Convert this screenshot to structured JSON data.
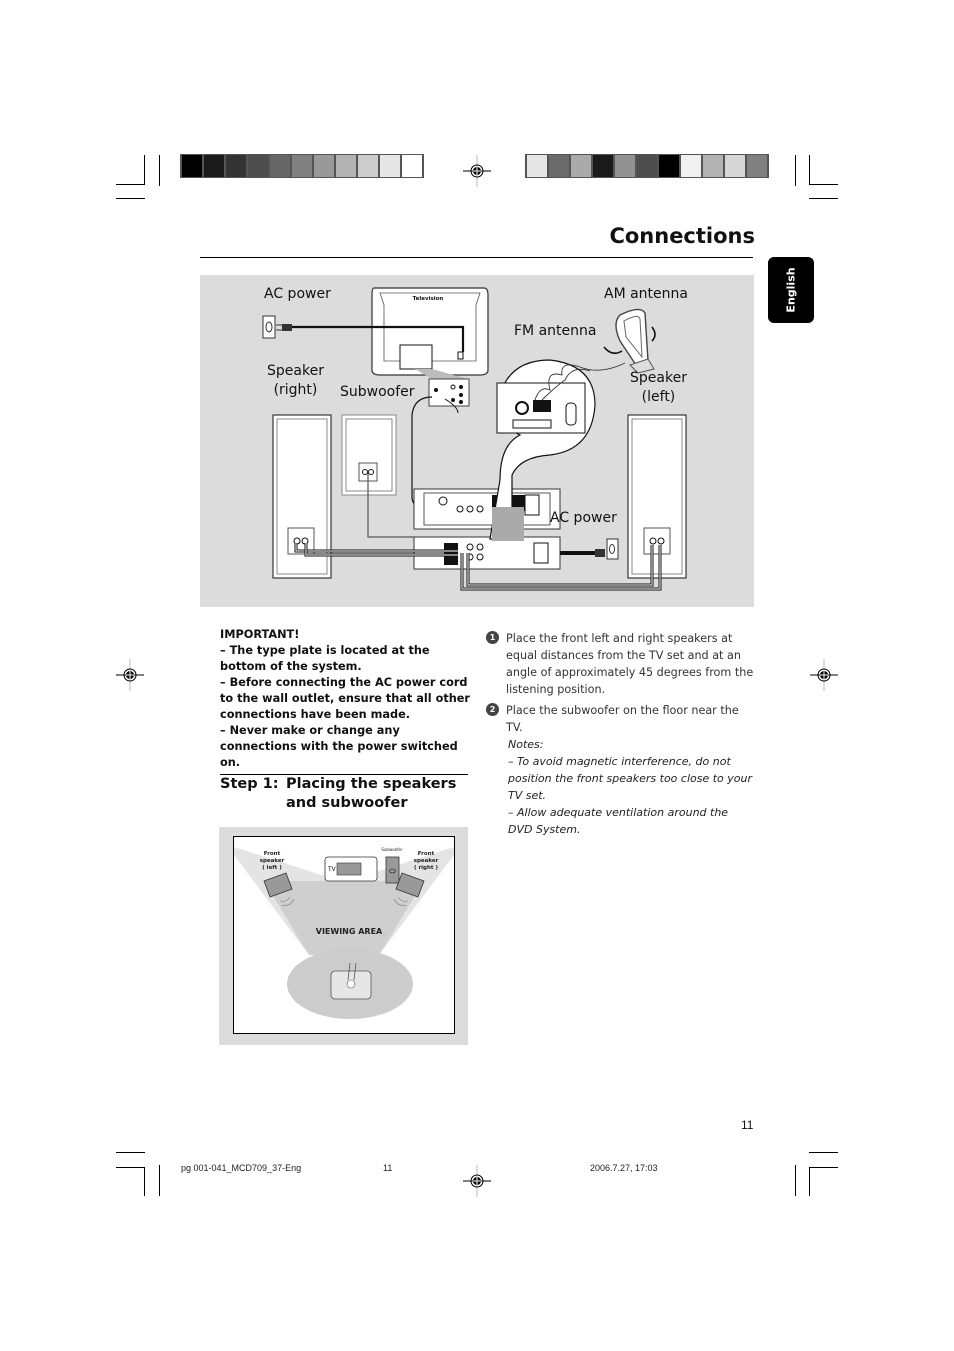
{
  "header": {
    "title": "Connections",
    "language_tab": "English",
    "color_bar_left": [
      "#000000",
      "#1a1a1a",
      "#333333",
      "#4d4d4d",
      "#666666",
      "#808080",
      "#999999",
      "#b3b3b3",
      "#cccccc",
      "#e6e6e6",
      "#ffffff"
    ],
    "color_bar_right": [
      "#e6e6e6",
      "#6b6b6b",
      "#aaaaaa",
      "#1a1a1a",
      "#919191",
      "#4d4d4d",
      "#000000",
      "#f0f0f0",
      "#b3b3b3",
      "#d6d6d6",
      "#808080"
    ]
  },
  "connection_diagram": {
    "labels": {
      "ac_power_top": "AC power",
      "television": "Television",
      "am_antenna": "AM antenna",
      "fm_antenna": "FM antenna",
      "speaker_right": "Speaker\n(right)",
      "subwoofer": "Subwoofer",
      "speaker_left": "Speaker\n(left)",
      "ac_power_bottom": "AC power"
    }
  },
  "important": {
    "heading": "IMPORTANT!",
    "items": [
      "–  The type plate is located at the bottom of the system.",
      "–  Before connecting the AC power cord to the wall outlet, ensure that all other connections have been made.",
      "–  Never make or change any connections with the power switched on."
    ]
  },
  "step": {
    "number": "Step 1:",
    "title": "Placing the speakers and subwoofer"
  },
  "instructions": [
    {
      "bullet": "1",
      "text": "Place the front left and right speakers at equal distances from the TV set and at an angle of approximately 45 degrees from the listening position."
    },
    {
      "bullet": "2",
      "text": "Place the subwoofer on the floor near the TV."
    }
  ],
  "notes": {
    "heading": "Notes:",
    "items": [
      "–   To avoid magnetic interference, do not position the front speakers too close to your TV set.",
      "–   Allow adequate ventilation around the DVD System."
    ]
  },
  "placement_diagram": {
    "front_left": "Front\nspeaker\n( left )",
    "front_right": "Front\nspeaker\n( right )",
    "subwoofer": "Subwoofer",
    "tv": "TV",
    "viewing_area": "VIEWING AREA"
  },
  "page_number": "11",
  "footer": {
    "file": "pg 001-041_MCD709_37-Eng",
    "page": "11",
    "datetime": "2006.7.27, 17:03"
  }
}
